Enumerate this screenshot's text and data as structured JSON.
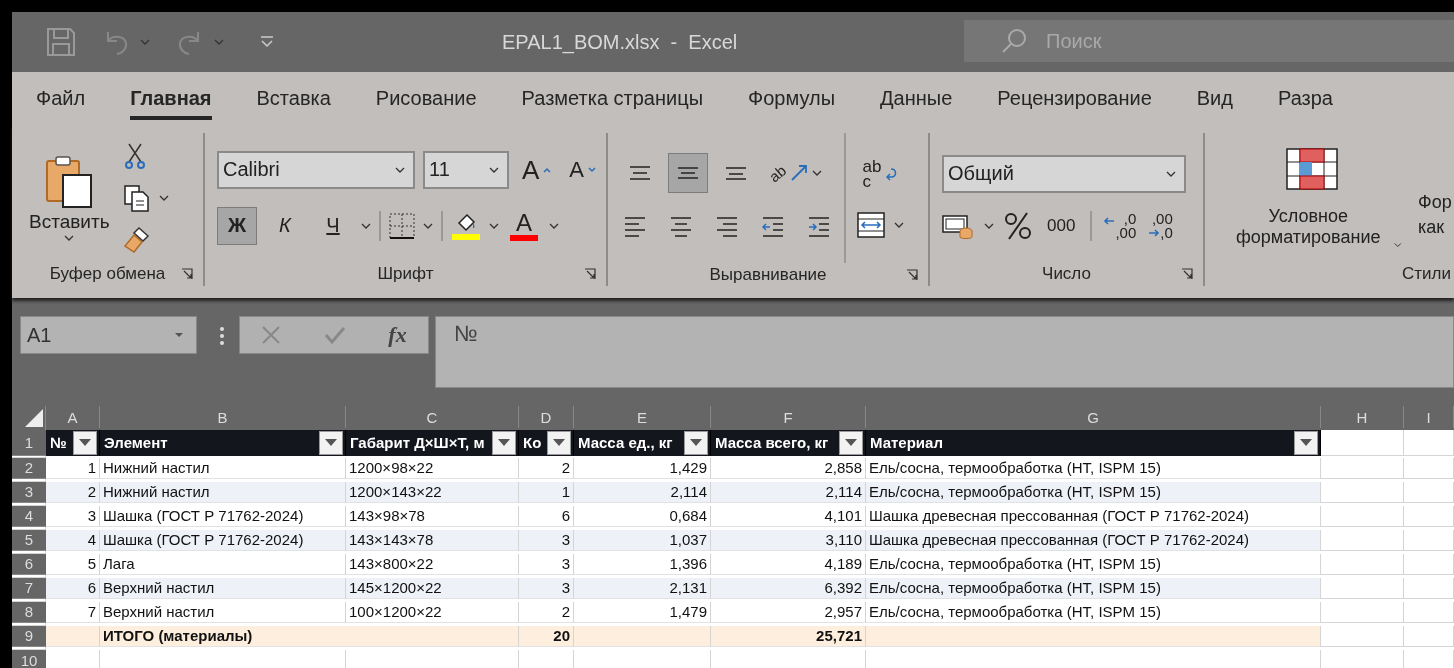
{
  "window": {
    "title": "EPAL1_BOM.xlsx  -  Excel"
  },
  "search": {
    "placeholder": "Поиск"
  },
  "ribbon_tabs": [
    {
      "label": "Файл",
      "selected": false
    },
    {
      "label": "Главная",
      "selected": true
    },
    {
      "label": "Вставка",
      "selected": false
    },
    {
      "label": "Рисование",
      "selected": false
    },
    {
      "label": "Разметка страницы",
      "selected": false
    },
    {
      "label": "Формулы",
      "selected": false
    },
    {
      "label": "Данные",
      "selected": false
    },
    {
      "label": "Рецензирование",
      "selected": false
    },
    {
      "label": "Вид",
      "selected": false
    },
    {
      "label": "Разра",
      "selected": false
    }
  ],
  "clipboard": {
    "paste": "Вставить",
    "group_label": "Буфер обмена"
  },
  "font": {
    "name": "Calibri",
    "size": "11",
    "grow": "A",
    "shrink": "A",
    "styles": [
      {
        "kind": "bold",
        "label": "Ж",
        "selected": true
      },
      {
        "kind": "italic",
        "label": "К",
        "selected": false
      },
      {
        "kind": "underline",
        "label": "Ч",
        "selected": false
      }
    ],
    "font_color": "A",
    "group_label": "Шрифт"
  },
  "alignment": {
    "vertical": [
      {
        "kind": "top",
        "selected": false
      },
      {
        "kind": "middle",
        "selected": true
      },
      {
        "kind": "bottom",
        "selected": false
      }
    ],
    "orientation_text": "ab",
    "wrap_text": [
      "ab",
      "c"
    ],
    "horizontal": [
      {
        "kind": "left",
        "selected": false
      },
      {
        "kind": "center",
        "selected": false
      },
      {
        "kind": "right",
        "selected": false
      },
      {
        "kind": "outdent",
        "selected": false
      },
      {
        "kind": "indent",
        "selected": false
      }
    ],
    "group_label": "Выравнивание"
  },
  "number": {
    "format": "Общий",
    "thousands": "000",
    "decimals": [
      {
        "kind": "increase",
        "top": ",0",
        "bottom": ",00"
      },
      {
        "kind": "decrease",
        "top": ",00",
        "bottom": ",0"
      }
    ],
    "group_label": "Число"
  },
  "styles": {
    "conditional": "Условное форматирование",
    "format_as_table": [
      "Фор",
      "как"
    ],
    "group_label": "Стили"
  },
  "formula_bar": {
    "name_box": "A1",
    "fx": "fx",
    "content": "№"
  },
  "sheet": {
    "columns": [
      "A",
      "B",
      "C",
      "D",
      "E",
      "F",
      "G",
      "H",
      "I"
    ],
    "row_numbers": [
      "1",
      "2",
      "3",
      "4",
      "5",
      "6",
      "7",
      "8",
      "9",
      "10"
    ],
    "header": [
      "№",
      "Элемент",
      "Габарит Д×Ш×Т, м",
      "Ко",
      "Масса ед., кг",
      "Масса всего, кг",
      "Материал"
    ],
    "rows": [
      [
        "1",
        "Нижний настил",
        "1200×98×22",
        "2",
        "1,429",
        "2,858",
        "Ель/сосна, термообработка (HT, ISPM 15)"
      ],
      [
        "2",
        "Нижний настил",
        "1200×143×22",
        "1",
        "2,114",
        "2,114",
        "Ель/сосна, термообработка (HT, ISPM 15)"
      ],
      [
        "3",
        "Шашка (ГОСТ Р 71762-2024)",
        "143×98×78",
        "6",
        "0,684",
        "4,101",
        "Шашка древесная прессованная (ГОСТ Р 71762-2024)"
      ],
      [
        "4",
        "Шашка (ГОСТ Р 71762-2024)",
        "143×143×78",
        "3",
        "1,037",
        "3,110",
        "Шашка древесная прессованная (ГОСТ Р 71762-2024)"
      ],
      [
        "5",
        "Лага",
        "143×800×22",
        "3",
        "1,396",
        "4,189",
        "Ель/сосна, термообработка (HT, ISPM 15)"
      ],
      [
        "6",
        "Верхний настил",
        "145×1200×22",
        "3",
        "2,131",
        "6,392",
        "Ель/сосна, термообработка (HT, ISPM 15)"
      ],
      [
        "7",
        "Верхний настил",
        "100×1200×22",
        "2",
        "1,479",
        "2,957",
        "Ель/сосна, термообработка (HT, ISPM 15)"
      ]
    ],
    "total": {
      "label": "ИТОГО (материалы)",
      "quantity": "20",
      "mass": "25,721"
    }
  }
}
